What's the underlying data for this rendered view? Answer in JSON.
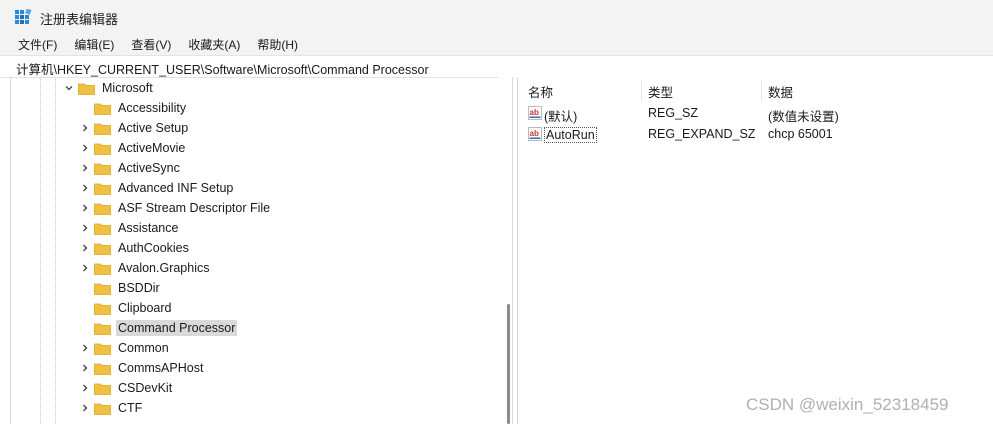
{
  "window": {
    "title": "注册表编辑器"
  },
  "menu": [
    "文件(F)",
    "编辑(E)",
    "查看(V)",
    "收藏夹(A)",
    "帮助(H)"
  ],
  "address": "计算机\\HKEY_CURRENT_USER\\Software\\Microsoft\\Command Processor",
  "tree": {
    "parent": {
      "label": "Microsoft",
      "expanded": true
    },
    "children": [
      {
        "label": "Accessibility",
        "has_children": false
      },
      {
        "label": "Active Setup",
        "has_children": true
      },
      {
        "label": "ActiveMovie",
        "has_children": true
      },
      {
        "label": "ActiveSync",
        "has_children": true
      },
      {
        "label": "Advanced INF Setup",
        "has_children": true
      },
      {
        "label": "ASF Stream Descriptor File",
        "has_children": true
      },
      {
        "label": "Assistance",
        "has_children": true
      },
      {
        "label": "AuthCookies",
        "has_children": true
      },
      {
        "label": "Avalon.Graphics",
        "has_children": true
      },
      {
        "label": "BSDDir",
        "has_children": false
      },
      {
        "label": "Clipboard",
        "has_children": false
      },
      {
        "label": "Command Processor",
        "has_children": false,
        "selected": true
      },
      {
        "label": "Common",
        "has_children": true
      },
      {
        "label": "CommsAPHost",
        "has_children": true
      },
      {
        "label": "CSDevKit",
        "has_children": true
      },
      {
        "label": "CTF",
        "has_children": true
      }
    ]
  },
  "values_pane": {
    "headers": {
      "name": "名称",
      "type": "类型",
      "data": "数据"
    },
    "rows": [
      {
        "name": "(默认)",
        "type": "REG_SZ",
        "data": "(数值未设置)"
      },
      {
        "name": "AutoRun",
        "type": "REG_EXPAND_SZ",
        "data": "chcp 65001",
        "focused": true
      }
    ]
  },
  "watermark": "CSDN @weixin_52318459",
  "colors": {
    "folder": "#f0c040",
    "folder_dark": "#d9a520",
    "selection": "#d9d9d9",
    "ab_icon": "#c0392b"
  }
}
